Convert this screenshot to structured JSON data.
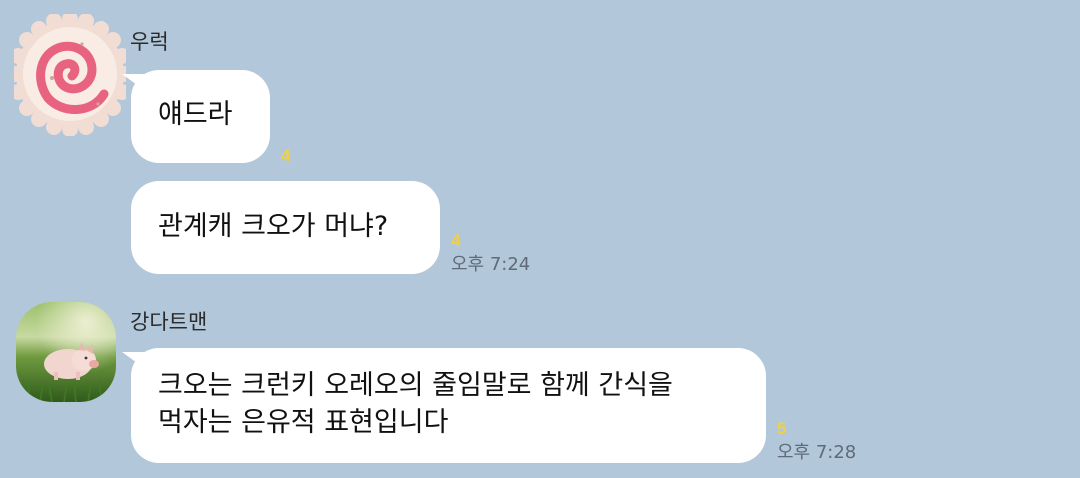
{
  "background_color": "#b2c7da",
  "messages": [
    {
      "sender": "우럭",
      "avatar_icon": "narutomaki-fishcake-avatar",
      "bubbles": [
        {
          "text": "얘드라",
          "unread": "4",
          "time": ""
        },
        {
          "text": "관계캐 크오가 머냐?",
          "unread": "4",
          "time": "오후 7:24"
        }
      ]
    },
    {
      "sender": "강다트맨",
      "avatar_icon": "piglet-photo-avatar",
      "bubbles": [
        {
          "line1": "크오는 크런키 오레오의 줄임말로 함께 간식을",
          "line2": "먹자는 은유적 표현입니다",
          "unread": "5",
          "time": "오후 7:28"
        }
      ]
    }
  ]
}
